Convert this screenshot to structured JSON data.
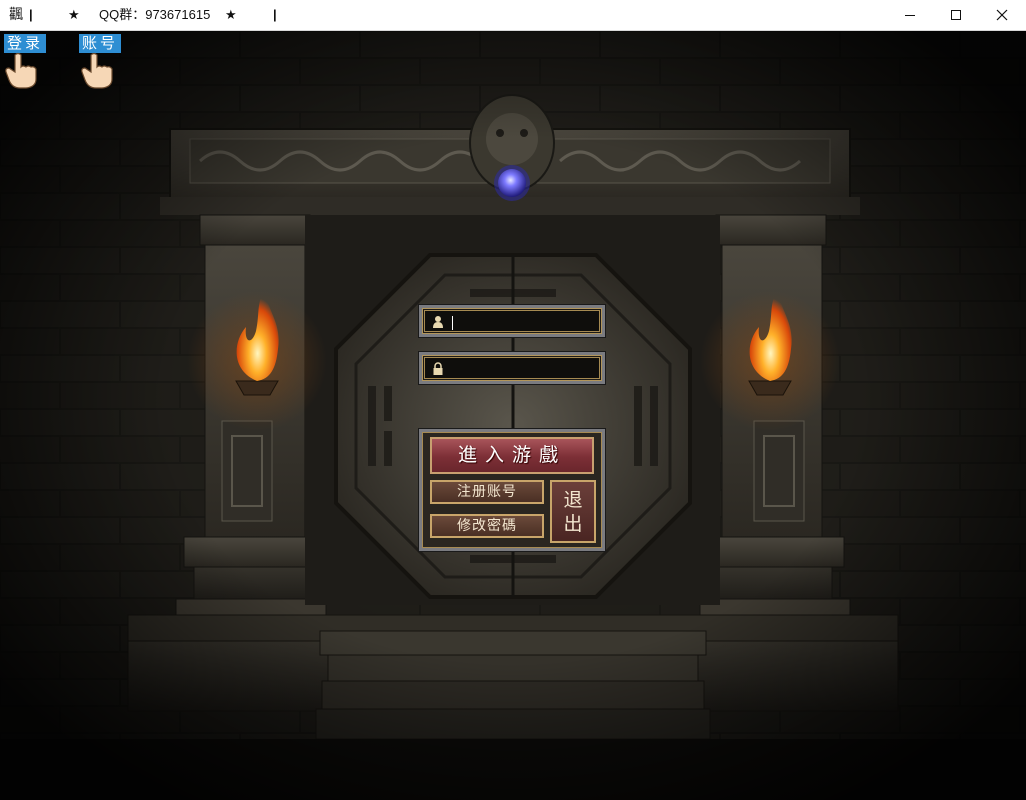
{
  "window": {
    "app_icon": "飌",
    "title_parts": [
      "|",
      "★",
      "QQ群：973671615",
      "★",
      "|"
    ],
    "controls": {
      "minimize": "minimize-icon",
      "maximize": "maximize-icon",
      "close": "close-icon"
    }
  },
  "hints": {
    "login_label": "登录",
    "account_label": "账号",
    "icon": "pointing-hand-icon"
  },
  "login": {
    "username": {
      "value": "",
      "icon": "user-icon"
    },
    "password": {
      "value": "",
      "icon": "lock-icon"
    },
    "enter_game": "進入游戲",
    "register": "注册账号",
    "change_password": "修改密碼",
    "exit": "退出"
  },
  "colors": {
    "hint_bg": "#2e8ed3",
    "enter_button": "#8c3a42",
    "orb": "#6e6cff",
    "flame": "#ff9a1e"
  }
}
